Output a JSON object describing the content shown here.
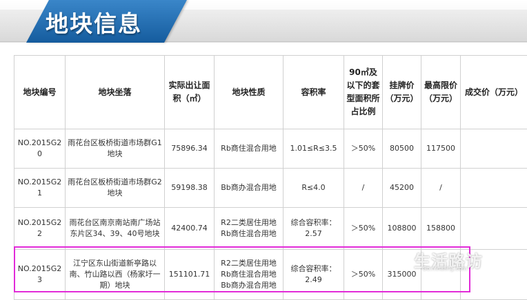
{
  "header": {
    "title": "地块信息"
  },
  "table": {
    "columns": [
      "地块编号",
      "地块坐落",
      "实际出让面积（㎡）",
      "地块性质",
      "容积率",
      "90㎡及以下的套型面积所占比例",
      "挂牌价（万元）",
      "最高限价（万元）",
      "成交价（万元）"
    ],
    "rows": [
      {
        "id": "NO.2015G20",
        "location": "雨花台区板桥街道市场群G1地块",
        "area": "75896.34",
        "nature": [
          "Rb商住混合用地"
        ],
        "far": [
          "1.01≤R≤3.5"
        ],
        "ratio": "＞50%",
        "list_price": "80500",
        "max_price": "117500",
        "deal_price": ""
      },
      {
        "id": "NO.2015G21",
        "location": "雨花台区板桥街道市场群G2地块",
        "area": "59198.38",
        "nature": [
          "Bb商办混合用地"
        ],
        "far": [
          "R≤4.0"
        ],
        "ratio": "/",
        "list_price": "45200",
        "max_price": "/",
        "deal_price": ""
      },
      {
        "id": "NO.2015G22",
        "location": "雨花台区南京南站南广场站东片区34、39、40号地块",
        "area": "42400.74",
        "nature": [
          "R2二类居住用地",
          "Rb商住混合用地"
        ],
        "far": [
          "综合容积率：",
          "2.57"
        ],
        "ratio": "＞50%",
        "list_price": "108800",
        "max_price": "158800",
        "deal_price": ""
      },
      {
        "id": "NO.2015G23",
        "location": "江宁区东山街道新亭路以南、竹山路以西（杨家圩一期）地块",
        "area": "151101.71",
        "nature": [
          "R2二类居住用地",
          "Rb商住混合用地",
          "Bb商办混合用地"
        ],
        "far": [
          "综合容积率：",
          "2.49"
        ],
        "ratio": "＞50%",
        "list_price": "315000",
        "max_price": "",
        "deal_price": ""
      }
    ]
  },
  "watermark": {
    "text": "生活路访",
    "site": "Go.mnaiing.com"
  },
  "colors": {
    "header_blue": "#1d6cb3",
    "highlight": "#e12ad8",
    "border": "#d0d0d0"
  }
}
